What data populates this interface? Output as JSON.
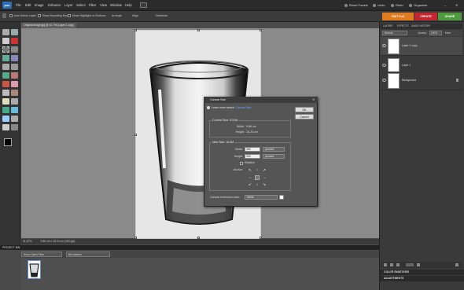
{
  "app": {
    "logo": "pse",
    "menu": [
      "File",
      "Edit",
      "Image",
      "Enhance",
      "Layer",
      "Select",
      "Filter",
      "View",
      "Window",
      "Help"
    ],
    "right_links": [
      "Reset Panels",
      "Undo",
      "Redo",
      "Organizer"
    ],
    "minimize": "–",
    "close": "✕"
  },
  "options": {
    "auto_select": "Auto Select Layer",
    "show_bounding": "Show Bounding Box",
    "show_highlight": "Show Highlight on Rollover",
    "arrange": "Arrange",
    "align": "Align",
    "distribute": "Distribute"
  },
  "modes": {
    "edit_full": "EDIT Full",
    "create": "CREATE",
    "share": "SHARE"
  },
  "document": {
    "tab_title": "Original image.jpg @ 41.7% (Layer 1 copy, RGB/8)",
    "tab_close": "×",
    "zoom": "41.67%",
    "doc_info": "9.86 cm x 15.24 cm (300 ppi)"
  },
  "project_bin": {
    "header": "PROJECT BIN",
    "selector": "Show Open Files",
    "bin_actions": "Bin Actions"
  },
  "panels": {
    "tabs": [
      "LAYERS",
      "EFFECTS",
      "UNDO HISTORY"
    ],
    "blend_mode": "Normal",
    "opacity_label": "Opacity:",
    "opacity_value": "100%",
    "more": "More",
    "layers": [
      {
        "name": "Layer 1 copy",
        "selected": true
      },
      {
        "name": "Layer 1",
        "selected": false
      },
      {
        "name": "Background",
        "selected": false,
        "locked": true
      }
    ],
    "color_swatches": "COLOR SWATCHES",
    "adjustments": "ADJUSTMENTS"
  },
  "dialog": {
    "title": "Canvas Size",
    "close": "✕",
    "learn_prefix": "Learn more about:",
    "learn_link": "Canvas Size",
    "ok": "OK",
    "cancel": "Cancel",
    "current_size_label": "Current Size: 5.01M",
    "current_width_label": "Width:",
    "current_width": "9.86 cm",
    "current_height_label": "Height:",
    "current_height": "15.24 cm",
    "new_size_label": "New Size: 15.0M",
    "width_label": "Width:",
    "width_value": "300",
    "width_unit": "percent",
    "height_label": "Height:",
    "height_value": "100",
    "height_unit": "percent",
    "relative": "Relative",
    "anchor_label": "Anchor:",
    "extension_label": "Canvas extension color:",
    "extension_value": "White"
  }
}
